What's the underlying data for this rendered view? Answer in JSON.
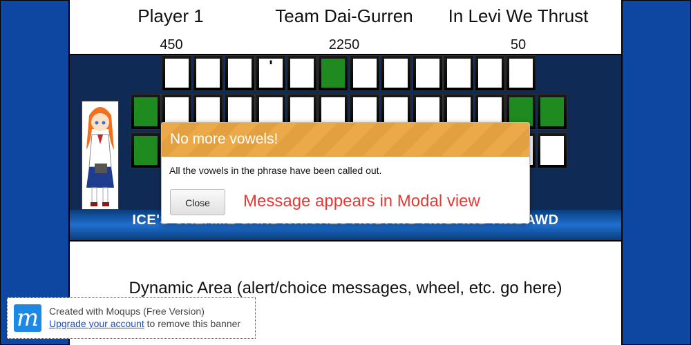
{
  "players": [
    {
      "name": "Player 1",
      "score": "450"
    },
    {
      "name": "Team Dai-Gurren",
      "score": "2250"
    },
    {
      "name": "In Levi We Thrust",
      "score": "50"
    }
  ],
  "board": {
    "apostrophe": "'",
    "phrase": "ICE'S CREAME SANDWHICHES AWDAWD AWDAWD AWDAWD"
  },
  "modal": {
    "title": "No more vowels!",
    "message": "All the vowels in the phrase have been called out.",
    "close_label": "Close",
    "note": "Message appears in Modal view"
  },
  "dynamic_area": "Dynamic Area (alert/choice messages, wheel, etc. go here)",
  "banner": {
    "line1": "Created with Moqups (Free Version)",
    "link": "Upgrade your account",
    "line2_suffix": " to remove this banner",
    "logo_letter": "m"
  },
  "colors": {
    "accent": "#eba94a",
    "note_red": "#e53935",
    "tile_green": "#1f8a1f",
    "side_blue": "#0d47a1"
  }
}
